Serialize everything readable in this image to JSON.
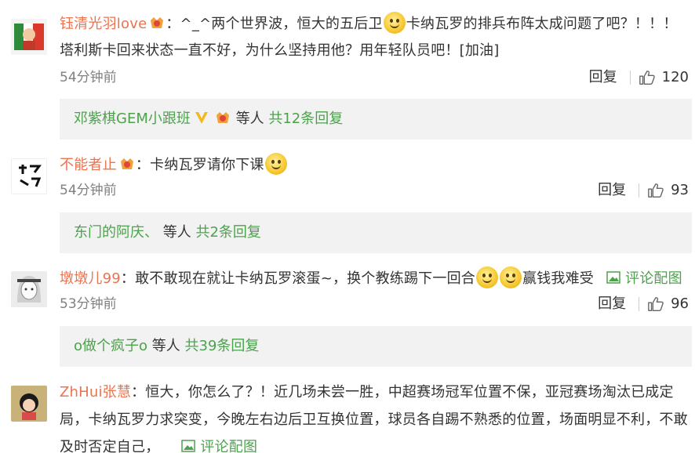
{
  "comments": [
    {
      "user": "钰清光羽love",
      "text_a": "：^_^两个世界波，恒大的五后卫",
      "text_b": "卡纳瓦罗的排兵布阵太成问题了吧？！！！塔利斯卡回来状态一直不好，为什么坚持用他？用年轻队员吧！[加油]",
      "time": "54分钟前",
      "reply_label": "回复",
      "likes": "120",
      "replies": {
        "user": "邓紫棋GEM小跟班",
        "others": "等人",
        "total": "共12条回复"
      }
    },
    {
      "user": "不能者止",
      "text_a": "：卡纳瓦罗请你下课",
      "time": "54分钟前",
      "reply_label": "回复",
      "likes": "93",
      "replies": {
        "user": "东门的阿庆、",
        "others": "等人",
        "total": "共2条回复"
      }
    },
    {
      "user": "墩墩儿99",
      "text_a": "：敢不敢现在就让卡纳瓦罗滚蛋~，换个教练踢下一回合",
      "text_b": "赢钱我难受",
      "pic_label": "评论配图",
      "time": "53分钟前",
      "reply_label": "回复",
      "likes": "96",
      "replies": {
        "user": "o做个疯子o",
        "others": "等人",
        "total": "共39条回复"
      }
    },
    {
      "user": "ZhHui张慧",
      "text_a": "：恒大，你怎么了？！近几场未尝一胜，中超赛场冠军位置不保，亚冠赛场淘汰已成定局，卡纳瓦罗力求突变，今晚左右边后卫互换位置，球员各自踢不熟悉的位置，场面明显不利，不敢及时否定自己，",
      "pic_label": "评论配图"
    }
  ],
  "colors": {
    "username": "#eb7350",
    "link": "#4ca24c",
    "reply_bg": "#f2f2f2"
  }
}
